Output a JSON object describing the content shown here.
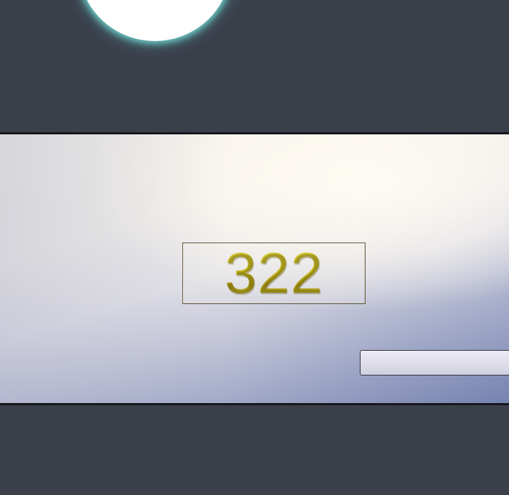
{
  "scene": {
    "door_plate": {
      "number": "322"
    },
    "colors": {
      "background": "#3b3f4a",
      "border": "#15171c",
      "plate_number_gold": "#c4b71d",
      "light_glow": "#9ff3ee"
    }
  }
}
